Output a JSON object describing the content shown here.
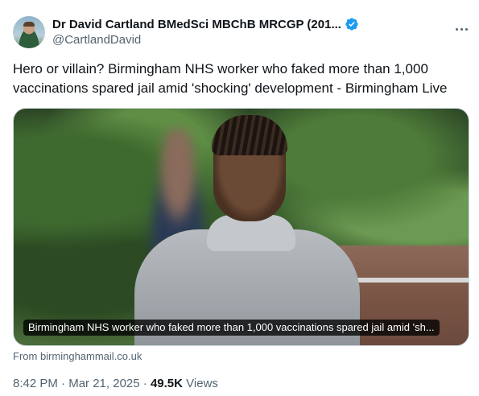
{
  "author": {
    "display_name": "Dr David Cartland BMedSci MBChB MRCGP (201...",
    "handle": "@CartlandDavid",
    "verified": true,
    "verified_color": "#1d9bf0"
  },
  "tweet": {
    "text": "Hero or villain? Birmingham NHS worker who faked more than 1,000 vaccinations spared jail amid 'shocking' development - Birmingham Live"
  },
  "card": {
    "caption": "Birmingham NHS worker who faked more than 1,000 vaccinations spared jail amid 'sh...",
    "source": "From birminghammail.co.uk"
  },
  "meta": {
    "time": "8:42 PM",
    "separator": "·",
    "date": "Mar 21, 2025",
    "views_count": "49.5K",
    "views_label": "Views"
  },
  "icons": {
    "verified": "verified-badge-icon",
    "more": "more-options-icon"
  }
}
